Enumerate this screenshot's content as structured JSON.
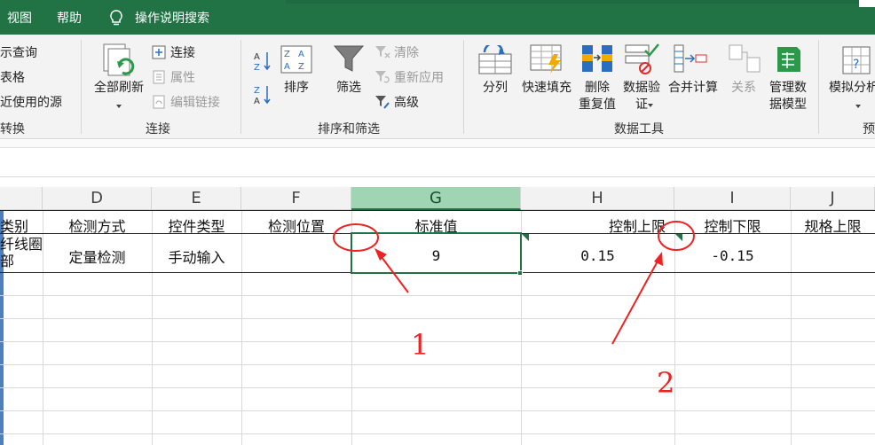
{
  "menu": {
    "tabs": [
      "视图",
      "帮助"
    ],
    "search_label": "操作说明搜索"
  },
  "ribbon": {
    "get_transform": {
      "items": [
        "示查询",
        "表格",
        "近使用的源"
      ],
      "label": "转换"
    },
    "connections": {
      "refresh_all": "全部刷新",
      "connections": "连接",
      "properties": "属性",
      "edit_links": "编辑链接",
      "label": "连接"
    },
    "sort_filter": {
      "sort": "排序",
      "filter": "筛选",
      "clear": "清除",
      "reapply": "重新应用",
      "advanced": "高级",
      "label": "排序和筛选"
    },
    "data_tools": {
      "text_to_columns": "分列",
      "flash_fill": "快速填充",
      "remove_dup_1": "删除",
      "remove_dup_2": "重复值",
      "validation_1": "数据验",
      "validation_2": "证",
      "consolidate": "合并计算",
      "relationships": "关系",
      "data_model_1": "管理数",
      "data_model_2": "据模型",
      "label": "数据工具"
    },
    "forecast": {
      "what_if": "模拟分析",
      "label": "预"
    }
  },
  "grid": {
    "columns": [
      "D",
      "E",
      "F",
      "G",
      "H",
      "I",
      "J"
    ],
    "header_row": {
      "c_partial": "类别",
      "D": "检测方式",
      "E": "控件类型",
      "F": "检测位置",
      "G": "标准值",
      "H": "控制上限",
      "I": "控制下限",
      "J": "规格上限"
    },
    "data_row": {
      "c_partial_1": "纤线圈",
      "c_partial_2": "部",
      "D": "定量检测",
      "E": "手动输入",
      "F": "",
      "G": "9",
      "H": "0.15",
      "I": "-0.15",
      "J": ""
    }
  },
  "annotations": {
    "label_1": "1",
    "label_2": "2",
    "color": "#ee2222"
  },
  "colors": {
    "excel_green": "#217346",
    "ribbon_bg": "#f3f3f3",
    "selected_header": "#a0d5b3"
  }
}
